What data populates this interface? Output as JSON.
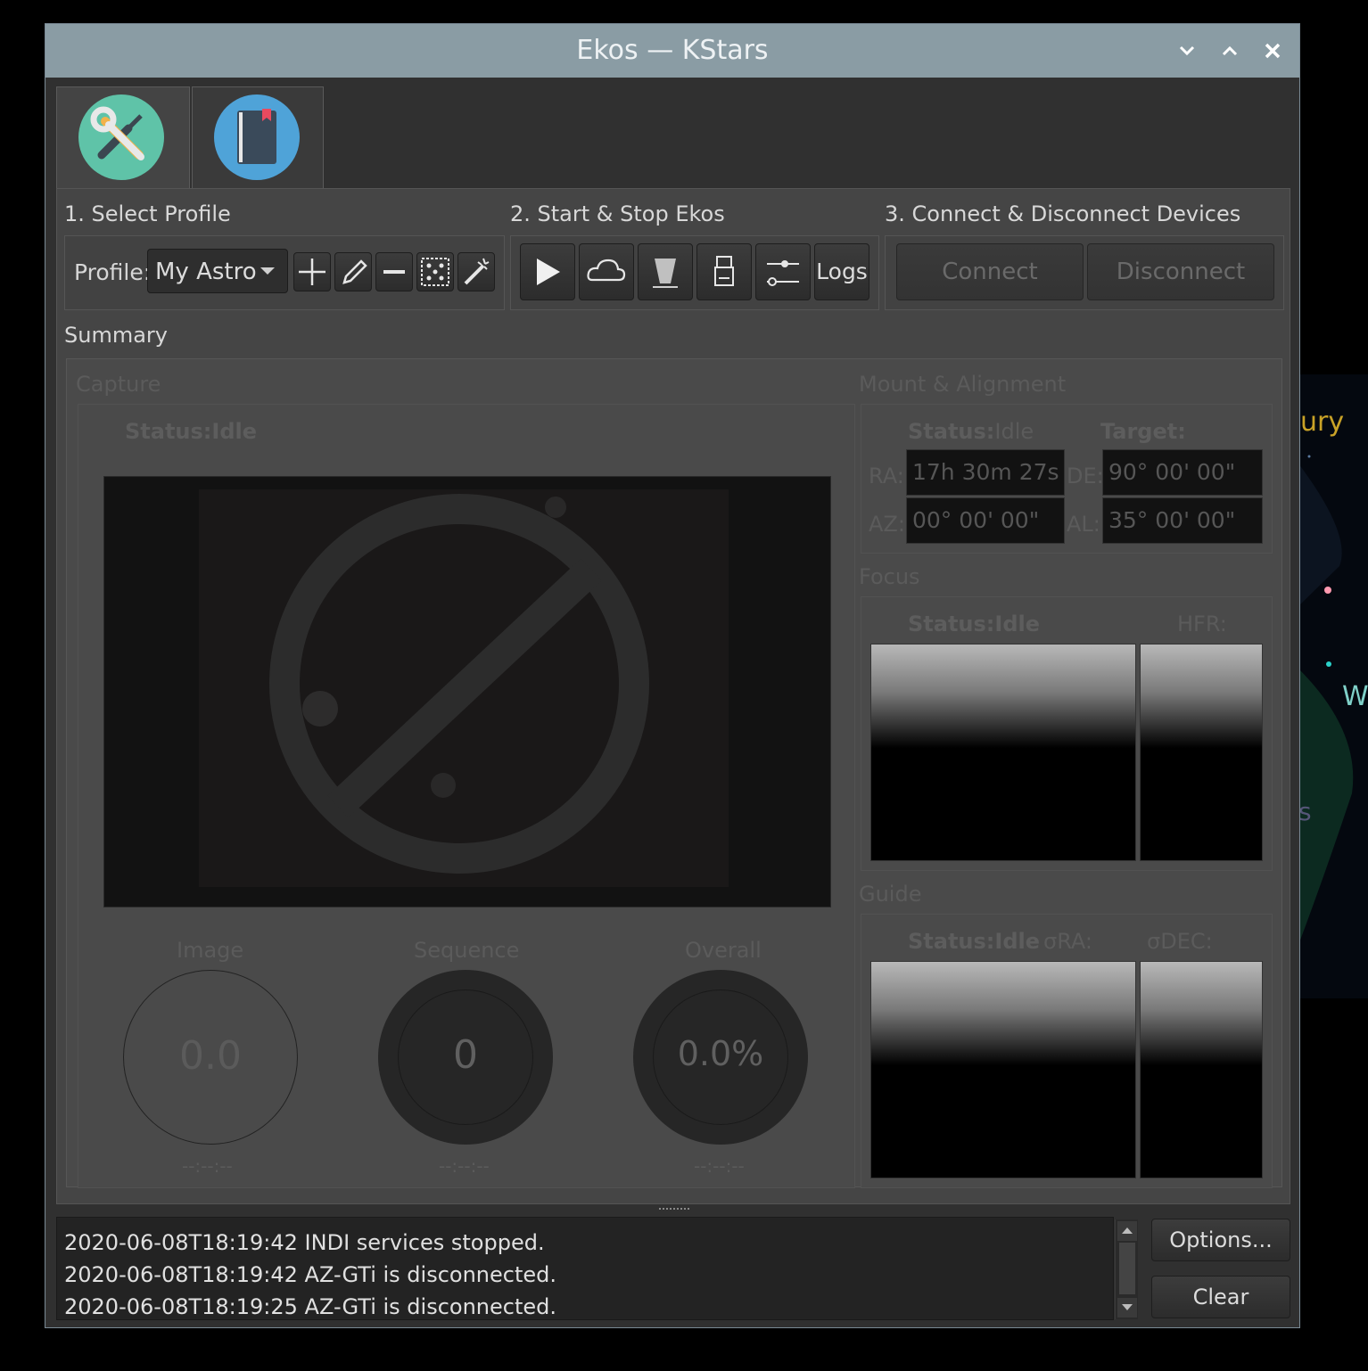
{
  "window": {
    "title": "Ekos — KStars",
    "controls": [
      "minimize",
      "maximize",
      "close"
    ]
  },
  "background_sky": {
    "labels": [
      "ury",
      "W",
      "s"
    ]
  },
  "tabs": [
    {
      "name": "setup",
      "icon": "wrench-screwdriver-icon",
      "active": true
    },
    {
      "name": "notebook",
      "icon": "notebook-icon",
      "active": false
    }
  ],
  "profile": {
    "step_label": "1. Select Profile",
    "field_label": "Profile:",
    "selected": "My Astro"
  },
  "start_stop": {
    "step_label": "2. Start & Stop Ekos",
    "logs_label": "Logs"
  },
  "devices": {
    "step_label": "3. Connect & Disconnect Devices",
    "connect_label": "Connect",
    "disconnect_label": "Disconnect"
  },
  "summary": {
    "label": "Summary",
    "capture": {
      "label": "Capture",
      "status_label": "Status:",
      "status_value": "Idle",
      "image_label": "Image",
      "image_value": "0.0",
      "image_time": "--:--:--",
      "sequence_label": "Sequence",
      "sequence_value": "0",
      "sequence_time": "--:--:--",
      "overall_label": "Overall",
      "overall_value": "0.0%",
      "overall_time": "--:--:--"
    },
    "mount": {
      "label": "Mount & Alignment",
      "status_label": "Status:",
      "status_value": "Idle",
      "target_label": "Target:",
      "ra_label": "RA:",
      "ra_value": "17h 30m 27s",
      "de_label": "DE:",
      "de_value": "90° 00' 00\"",
      "az_label": "AZ:",
      "az_value": "00° 00' 00\"",
      "al_label": "AL:",
      "al_value": "35° 00' 00\""
    },
    "focus": {
      "label": "Focus",
      "status_label": "Status:",
      "status_value": "Idle",
      "hfr_label": "HFR:"
    },
    "guide": {
      "label": "Guide",
      "status_label": "Status:",
      "status_value": "Idle",
      "sra_label": "σRA:",
      "sdec_label": "σDEC:"
    }
  },
  "log": {
    "lines": [
      "2020-06-08T18:19:42 INDI services stopped.",
      "2020-06-08T18:19:42 AZ-GTi is disconnected.",
      "2020-06-08T18:19:25 AZ-GTi is disconnected."
    ],
    "options_label": "Options...",
    "clear_label": "Clear"
  }
}
